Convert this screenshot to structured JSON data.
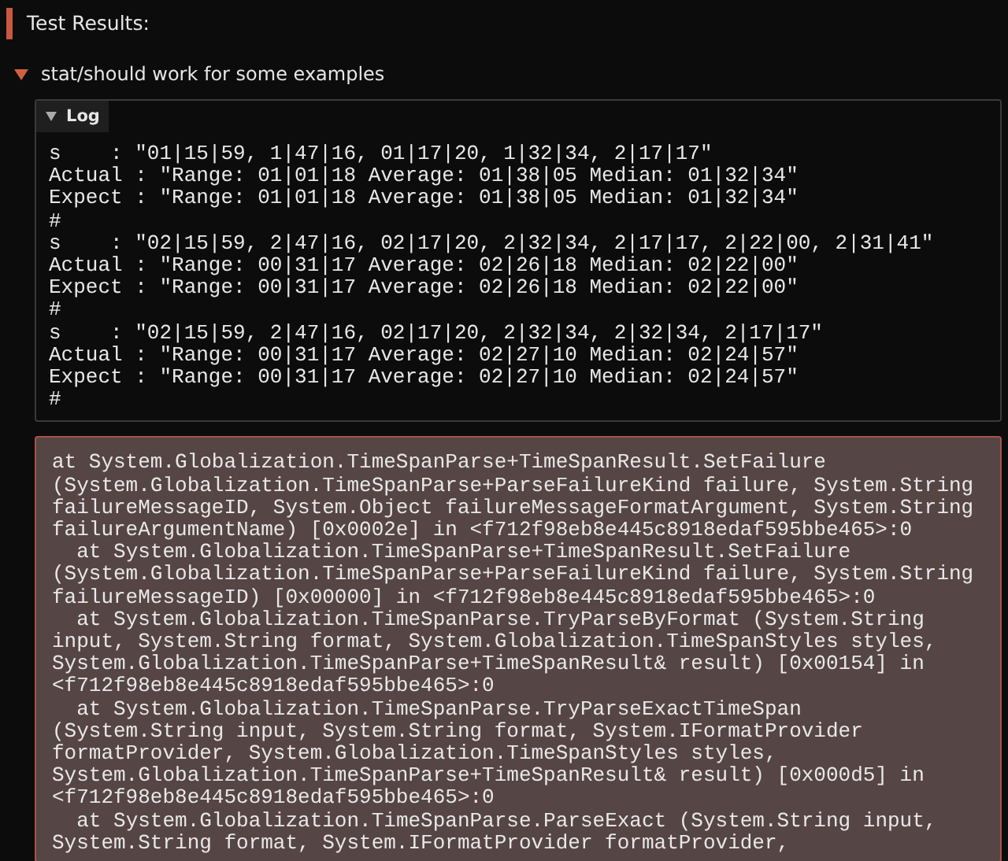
{
  "header": {
    "title": "Test Results:"
  },
  "tests": [
    {
      "name": "stat/should work for some examples",
      "expanded": true,
      "log": {
        "label": "Log",
        "expanded": true,
        "lines": [
          "s    : \"01|15|59, 1|47|16, 01|17|20, 1|32|34, 2|17|17\"",
          "Actual : \"Range: 01|01|18 Average: 01|38|05 Median: 01|32|34\"",
          "Expect : \"Range: 01|01|18 Average: 01|38|05 Median: 01|32|34\"",
          "#",
          "s    : \"02|15|59, 2|47|16, 02|17|20, 2|32|34, 2|17|17, 2|22|00, 2|31|41\"",
          "Actual : \"Range: 00|31|17 Average: 02|26|18 Median: 02|22|00\"",
          "Expect : \"Range: 00|31|17 Average: 02|26|18 Median: 02|22|00\"",
          "#",
          "s    : \"02|15|59, 2|47|16, 02|17|20, 2|32|34, 2|32|34, 2|17|17\"",
          "Actual : \"Range: 00|31|17 Average: 02|27|10 Median: 02|24|57\"",
          "Expect : \"Range: 00|31|17 Average: 02|27|10 Median: 02|24|57\"",
          "#"
        ]
      },
      "error": {
        "frames": [
          "at System.Globalization.TimeSpanParse+TimeSpanResult.SetFailure (System.Globalization.TimeSpanParse+ParseFailureKind failure, System.String failureMessageID, System.Object failureMessageFormatArgument, System.String failureArgumentName) [0x0002e] in <f712f98eb8e445c8918edaf595bbe465>:0",
          "  at System.Globalization.TimeSpanParse+TimeSpanResult.SetFailure (System.Globalization.TimeSpanParse+ParseFailureKind failure, System.String failureMessageID) [0x00000] in <f712f98eb8e445c8918edaf595bbe465>:0",
          "  at System.Globalization.TimeSpanParse.TryParseByFormat (System.String input, System.String format, System.Globalization.TimeSpanStyles styles, System.Globalization.TimeSpanParse+TimeSpanResult& result) [0x00154] in <f712f98eb8e445c8918edaf595bbe465>:0",
          "  at System.Globalization.TimeSpanParse.TryParseExactTimeSpan (System.String input, System.String format, System.IFormatProvider formatProvider, System.Globalization.TimeSpanStyles styles, System.Globalization.TimeSpanParse+TimeSpanResult& result) [0x000d5] in <f712f98eb8e445c8918edaf595bbe465>:0",
          "  at System.Globalization.TimeSpanParse.ParseExact (System.String input, System.String format, System.IFormatProvider formatProvider,"
        ]
      }
    }
  ]
}
